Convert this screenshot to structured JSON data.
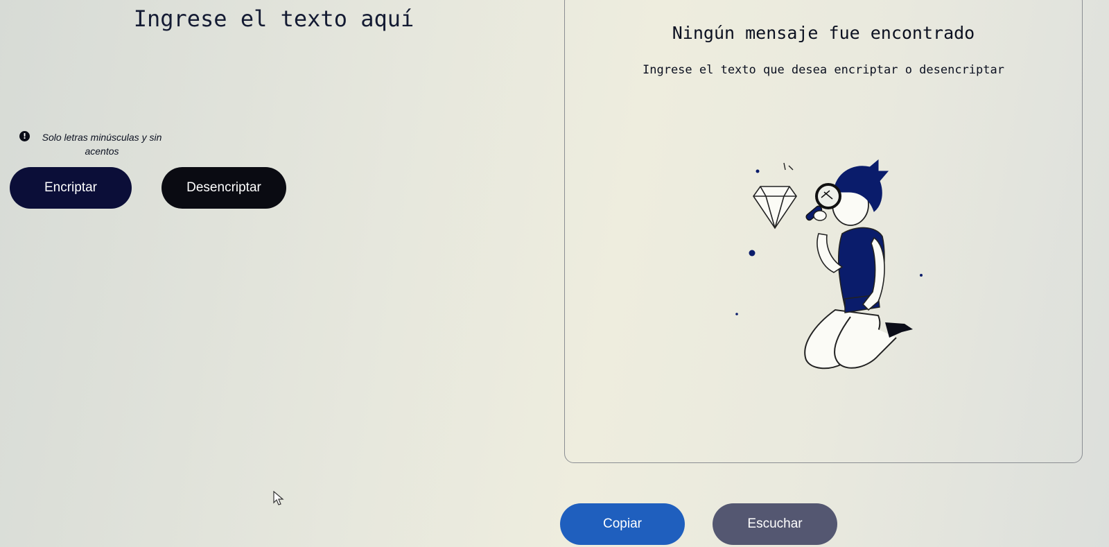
{
  "input": {
    "placeholder": "Ingrese el texto aquí"
  },
  "hint": {
    "icon": "exclamation-circle-icon",
    "text": "Solo letras minúsculas y sin acentos"
  },
  "buttons": {
    "encrypt_label": "Encriptar",
    "decrypt_label": "Desencriptar",
    "copy_label": "Copiar",
    "listen_label": "Escuchar"
  },
  "output": {
    "title": "Ningún mensaje fue encontrado",
    "subtitle": "Ingrese el texto que desea encriptar o desencriptar",
    "illustration": "person-with-magnifying-glass-and-diamond"
  },
  "colors": {
    "encrypt_button": "#0b0e38",
    "decrypt_button": "#0a0b12",
    "copy_button": "#1f5fbe",
    "listen_button": "#545771",
    "illustration_accent": "#0a1c6b"
  }
}
